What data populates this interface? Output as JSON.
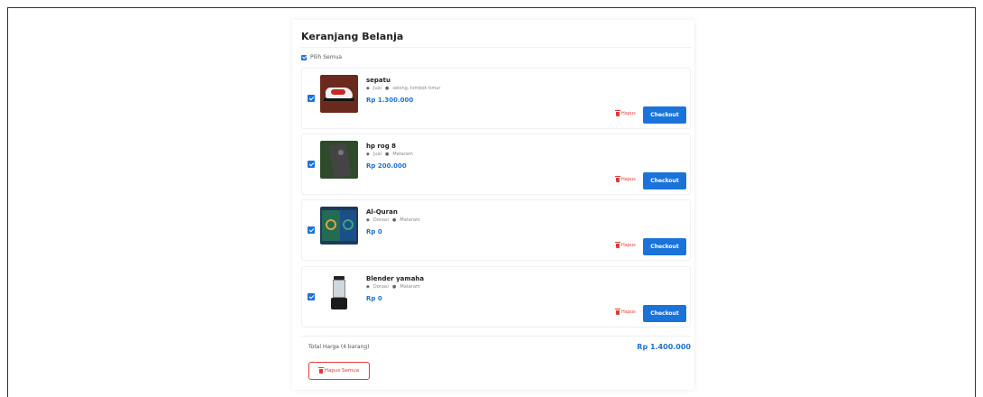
{
  "header": {
    "partial_text": "' ... jang"
  },
  "cart": {
    "title": "Keranjang Belanja",
    "select_all_label": "Pilih Semua",
    "items": [
      {
        "name": "sepatu",
        "type": "Jual",
        "location": "selong, lombok timur",
        "price": "Rp 1.300.000",
        "delete_label": "Hapus",
        "checkout_label": "Checkout",
        "image": "shoe"
      },
      {
        "name": "hp rog 8",
        "type": "Jual",
        "location": "Mataram",
        "price": "Rp 200.000",
        "delete_label": "Hapus",
        "checkout_label": "Checkout",
        "image": "phone"
      },
      {
        "name": "Al-Quran",
        "type": "Donasi",
        "location": "Mataram",
        "price": "Rp 0",
        "delete_label": "Hapus",
        "checkout_label": "Checkout",
        "image": "book"
      },
      {
        "name": "Blender yamaha",
        "type": "Donasi",
        "location": "Mataram",
        "price": "Rp 0",
        "delete_label": "Hapus",
        "checkout_label": "Checkout",
        "image": "blender"
      }
    ],
    "total_label": "Total Harga (4 barang)",
    "total_value": "Rp 1.400.000",
    "delete_all_label": "Hapus Semua"
  },
  "colors": {
    "accent": "#1a73d9",
    "danger": "#e53935"
  }
}
